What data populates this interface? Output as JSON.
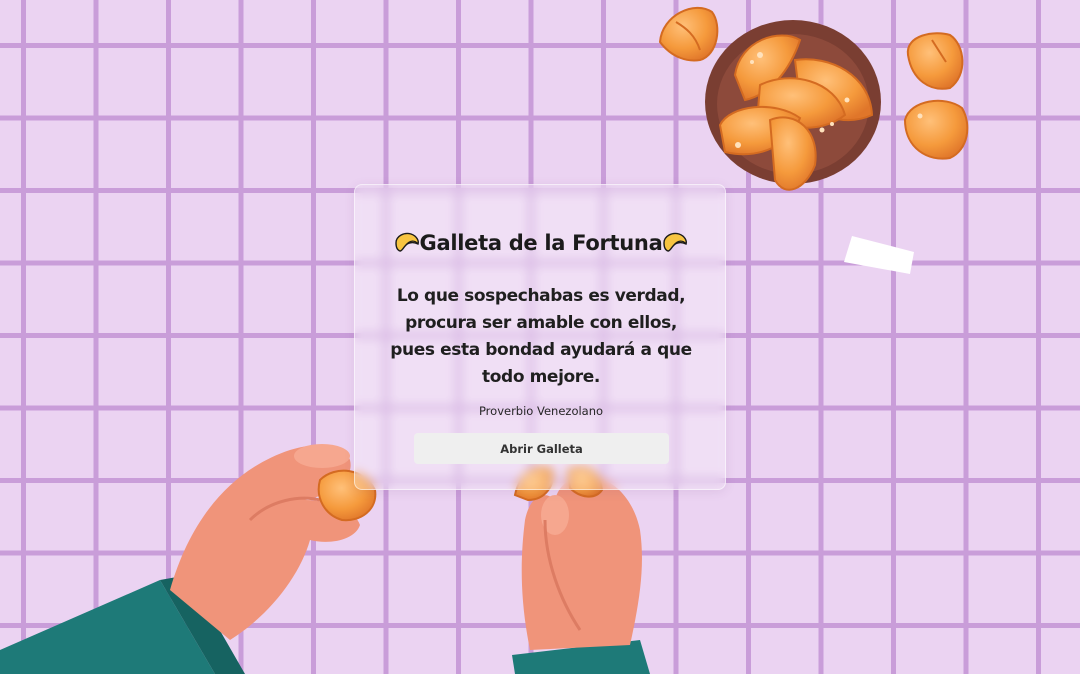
{
  "card": {
    "title": "Galleta de la Fortuna",
    "message": "Lo que sospechabas es verdad, procura ser amable con ellos, pues esta bondad ayudará a que todo mejore.",
    "author": "Proverbio Venezolano",
    "button_label": "Abrir Galleta"
  },
  "theme": {
    "background": "#ebd3f2",
    "grid_line": "#c99dd9",
    "cookie": "#f59a3c",
    "skin": "#f0947a",
    "sleeve": "#1e7a78",
    "bowl": "#7a3e32"
  },
  "icons": {
    "title_left": "fortune-cookie-icon",
    "title_right": "fortune-cookie-icon"
  }
}
